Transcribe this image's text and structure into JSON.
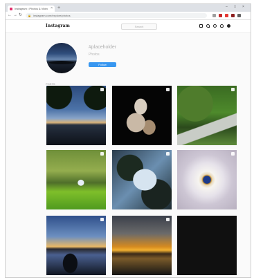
{
  "browser": {
    "tab_title": "Instagram • Photos & Videos",
    "new_tab": "+",
    "tab_close": "×",
    "window_controls": [
      "–",
      "□",
      "×"
    ],
    "nav": {
      "back": "←",
      "forward": "→",
      "reload": "↻"
    },
    "lock": "🔒",
    "url": "instagram.com/explore/photos",
    "extension_colors": [
      "#9e9e9e",
      "#c62828",
      "#e53935",
      "#8d1f1f",
      "#616161"
    ]
  },
  "instagram": {
    "logo": "Instagram",
    "search_placeholder": "Search"
  },
  "profile": {
    "username": "#placeholder",
    "subtext": "Photos",
    "follow_label": "Follow"
  },
  "section_label": "POSTS",
  "colors": {
    "accent": "#3897f0",
    "text": "#262626",
    "muted": "#999999",
    "background": "#fafafa"
  },
  "posts": [
    "night-sky-trees-photo",
    "two-people-dark-photo",
    "tree-lined-path-photo",
    "person-in-park-photo",
    "tree-canopy-sky-photo",
    "daisy-closeup-photo",
    "lake-sunset-silhouette-photo",
    "orange-sunset-river-photo",
    "dark-photo"
  ]
}
